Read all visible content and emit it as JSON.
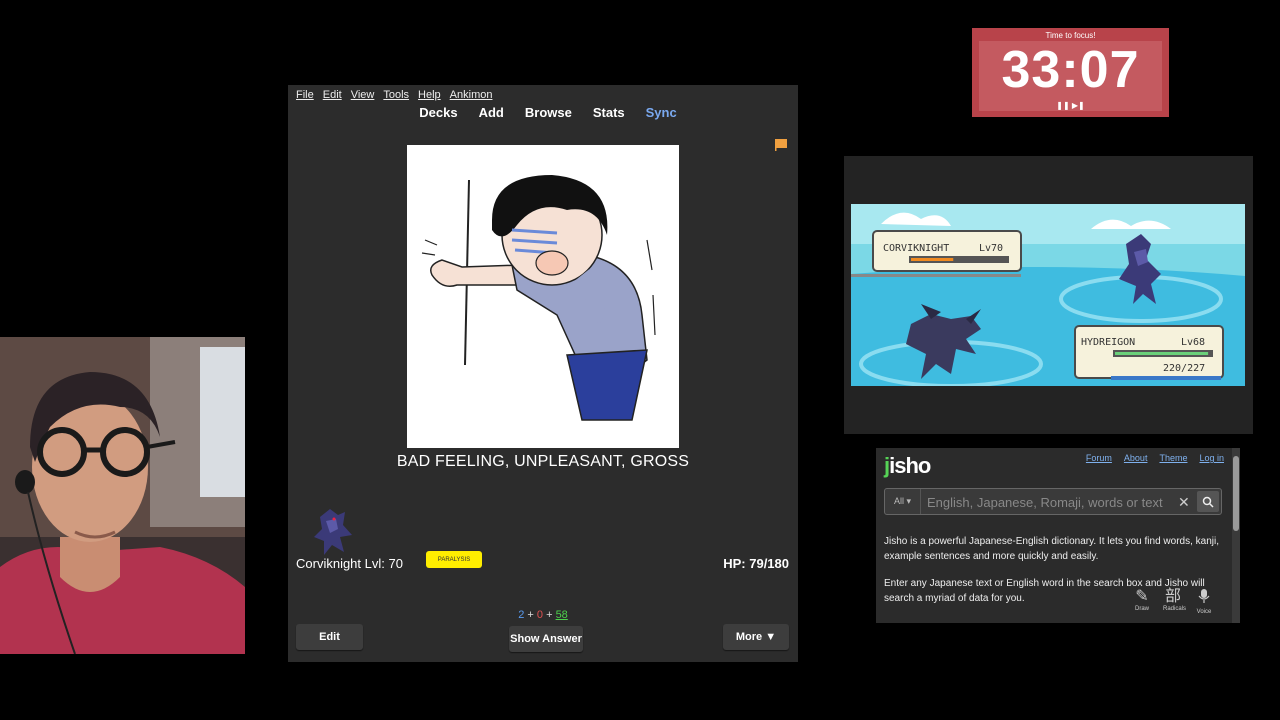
{
  "anki": {
    "menu": [
      "File",
      "Edit",
      "View",
      "Tools",
      "Help",
      "Ankimon"
    ],
    "toolbar": [
      "Decks",
      "Add",
      "Browse",
      "Stats",
      "Sync"
    ],
    "card": {
      "meaning": "BAD FEELING, UNPLEASANT, GROSS"
    },
    "pokemon": {
      "name_level": "Corviknight Lvl: 70",
      "status": "PARALYSIS",
      "hp": "HP: 79/180"
    },
    "counts": {
      "new": "2",
      "learn": "0",
      "review": "58",
      "plus": "+"
    },
    "buttons": {
      "edit": "Edit",
      "show_answer": "Show Answer",
      "more": "More ▼"
    }
  },
  "timer": {
    "label": "Time to focus!",
    "time": "33:07",
    "controls": "❚❚ ▶❚"
  },
  "game": {
    "enemy": {
      "name": "CORVIKNIGHT",
      "level": "Lv70",
      "hp_fraction": 0.44
    },
    "player": {
      "name": "HYDREIGON",
      "level": "Lv68",
      "hp_text": "220/227",
      "hp_fraction": 0.97
    }
  },
  "jisho": {
    "logo": "jisho",
    "nav": [
      "Forum",
      "About",
      "Theme",
      "Log in"
    ],
    "search": {
      "filter": "All ▾",
      "placeholder": "English, Japanese, Romaji, words or text"
    },
    "para1": "Jisho is a powerful Japanese-English dictionary. It lets you find words, kanji, example sentences and more quickly and easily.",
    "para2": "Enter any Japanese text or English word in the search box and Jisho will search a myriad of data for you.",
    "tools": {
      "draw": "Draw",
      "radicals": "Radicals",
      "radicals_glyph": "部",
      "voice": "Voice"
    }
  },
  "colors": {
    "timer_bg": "#b8434a",
    "anki_bg": "#2c2c2c",
    "sync": "#7aa9f0",
    "jisho_green": "#56d356",
    "status_badge": "#ffee00"
  }
}
